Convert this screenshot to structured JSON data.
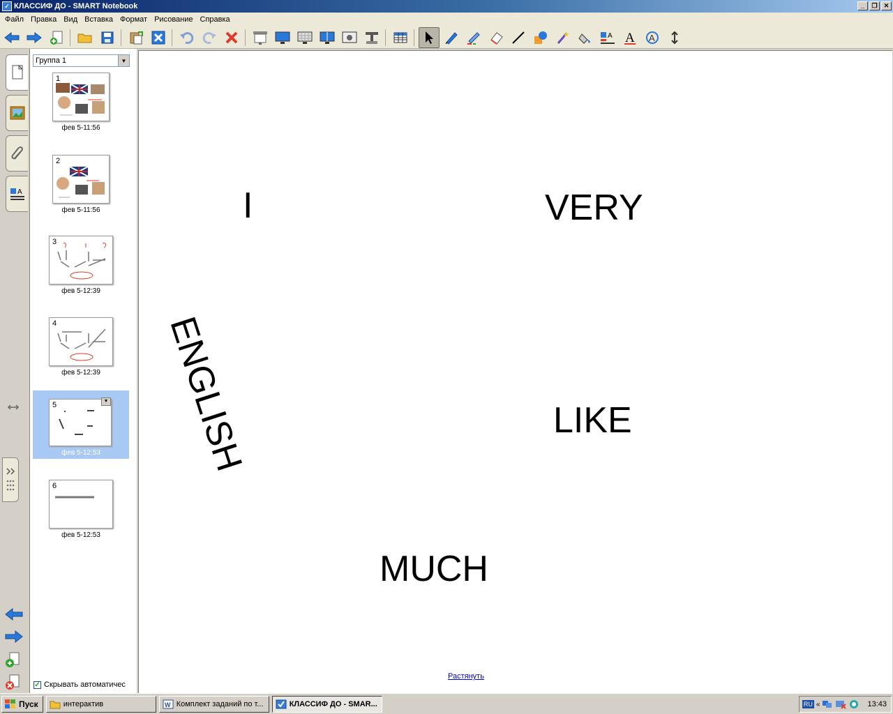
{
  "window": {
    "title": "КЛАССИФ ДО - SMART Notebook",
    "min_label": "_",
    "restore_label": "❐",
    "close_label": "✕"
  },
  "menu": [
    "Файл",
    "Правка",
    "Вид",
    "Вставка",
    "Формат",
    "Рисование",
    "Справка"
  ],
  "toolbar": {
    "icons": [
      "back-arrow-icon",
      "forward-arrow-icon",
      "add-page-icon",
      "open-folder-icon",
      "save-icon",
      "paste-icon",
      "delete-page-icon",
      "undo-icon",
      "redo-icon",
      "delete-icon",
      "screen-shade-icon",
      "full-screen-icon",
      "transparent-background-icon",
      "dual-page-icon",
      "screen-capture-icon",
      "document-camera-icon",
      "table-icon",
      "select-icon",
      "pen-icon",
      "creative-pen-icon",
      "eraser-icon",
      "line-icon",
      "shapes-icon",
      "magic-pen-icon",
      "fill-icon",
      "properties-icon",
      "text-icon",
      "recognize-icon",
      "move-toolbar-icon"
    ],
    "active_tool": "select-icon"
  },
  "sidebar": {
    "tabs": [
      "page-sorter-tab",
      "gallery-tab",
      "attachments-tab",
      "properties-tab"
    ],
    "group": "Группа 1",
    "thumbnails": [
      {
        "num": "1",
        "date": "фев 5-11:56"
      },
      {
        "num": "2",
        "date": "фев 5-11:56"
      },
      {
        "num": "3",
        "date": "фев 5-12:39"
      },
      {
        "num": "4",
        "date": "фев 5-12:39"
      },
      {
        "num": "5",
        "date": "фев 5-12:53",
        "selected": true
      },
      {
        "num": "6",
        "date": "фев 5-12:53"
      }
    ],
    "autohide_label": "Скрывать автоматичес",
    "autohide_checked": true
  },
  "page": {
    "words": {
      "i": "I",
      "very": "VERY",
      "english": "ENGLISH",
      "like": "LIKE",
      "much": "MUCH"
    },
    "stretch_link": "Растянуть"
  },
  "taskbar": {
    "start": "Пуск",
    "tasks": [
      {
        "label": "интерактив",
        "icon": "folder-icon"
      },
      {
        "label": "Комплект заданий по т...",
        "icon": "word-icon"
      },
      {
        "label": "КЛАССИФ ДО - SMAR...",
        "icon": "smart-notebook-icon",
        "pressed": true
      }
    ],
    "lang": "RU",
    "clock": "13:43"
  }
}
